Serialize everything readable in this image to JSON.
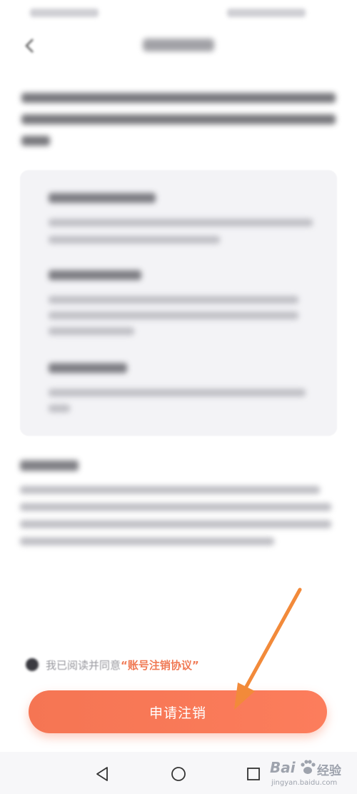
{
  "agreement": {
    "prefix": "我已阅读并同意",
    "link_label": "“账号注销协议”"
  },
  "apply_button": {
    "label": "申请注销"
  },
  "watermark": {
    "brand": "Bai",
    "brand_cn": "经验",
    "domain": "jingyan.baidu.com"
  },
  "colors": {
    "accent": "#f57553",
    "link": "#f07a55",
    "arrow": "#f28a3a",
    "card_background": "#f3f3f6"
  },
  "icons": {
    "back": "back-arrow-icon",
    "system_back": "triangle-back-icon",
    "system_home": "circle-home-icon",
    "system_recent": "square-recent-icon"
  }
}
